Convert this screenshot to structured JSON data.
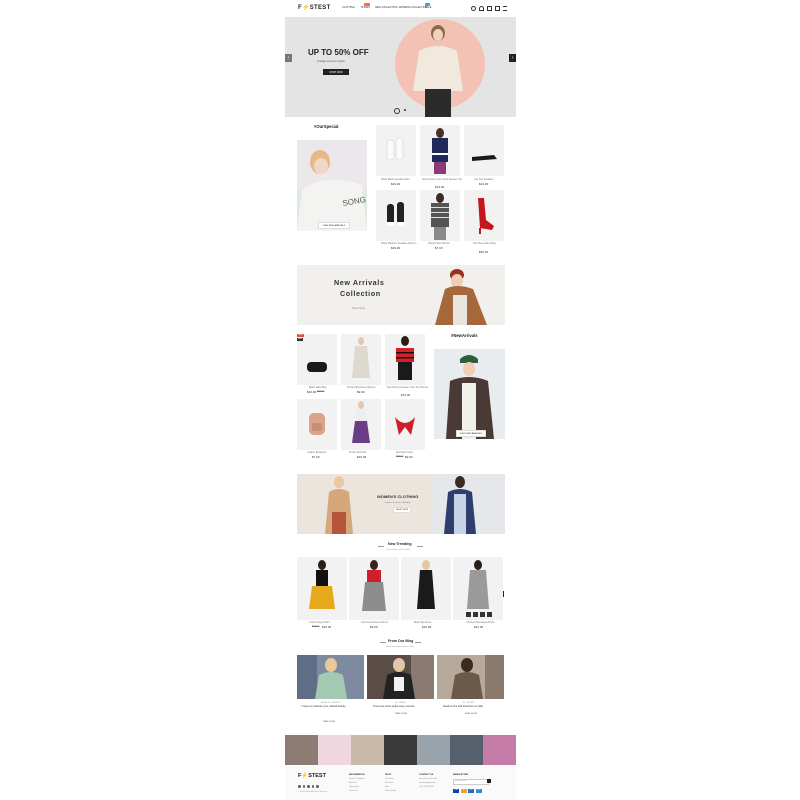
{
  "header": {
    "logo": "F⚡STEST",
    "nav": [
      "CLOTHING",
      "SHOES",
      "NEW COLLECTION",
      "WOMENS COLLECTION",
      "SALE"
    ],
    "badge_new": "NEW",
    "badge_hot": "HOT",
    "icons": [
      "search-icon",
      "user-icon",
      "heart-icon",
      "cart-icon",
      "menu-icon"
    ]
  },
  "hero": {
    "title": "UP TO 50% OFF",
    "subtitle": "vintage summer styles",
    "button": "SHOP NOW",
    "prev": "‹",
    "next": "›"
  },
  "special": {
    "title": "#OurSpecial",
    "banner_button": "VIEW NEW ARRIVALS",
    "products": [
      {
        "name": "White Black Sneakers Men",
        "price": "$29.00"
      },
      {
        "name": "Striped Navy Crew Neck Sweater Top",
        "price": "$19.00"
      },
      {
        "name": "Low Top Sneakers",
        "price": "$19.00"
      },
      {
        "name": "White Platform Sneakers Women",
        "price": "$39.00"
      },
      {
        "name": "Striped Shirt Women",
        "price": "$7.00"
      },
      {
        "name": "Red Heel Ankle Strap",
        "price": "$45.00"
      }
    ]
  },
  "arrivals_banner": {
    "title_line1": "New Arrivals",
    "title_line2": "Collection",
    "link": "Shop Now"
  },
  "new_arrivals": {
    "title": "#NewArrivals",
    "banner_button": "SHOP NEW ARRIVALS",
    "badge_sale": "SALE",
    "badge_new": "NEW",
    "products": [
      {
        "name": "Black Waist Bag",
        "price": "$30.00",
        "old_price": "$45.00"
      },
      {
        "name": "Printed Midi Dress Women",
        "price": "$9.99",
        "old_price": ""
      },
      {
        "name": "Red Striped Sweater Crop Top Women",
        "price": "$14.00",
        "old_price": ""
      },
      {
        "name": "Leather Backpack",
        "price": "$7.00",
        "old_price": ""
      },
      {
        "name": "Purple Midi Skirt",
        "price": "$19.00",
        "old_price": ""
      },
      {
        "name": "Red Neck Scarf",
        "price": "$9.00",
        "old_price": "$12.00"
      }
    ]
  },
  "womens_banner": {
    "title": "WOMEN'S CLOTHING",
    "subtitle": "autumn & winter collection",
    "button": "SHOP NOW"
  },
  "trending": {
    "title": "New Trending",
    "subtitle": "Top products of the week",
    "prev": "‹",
    "next": "›",
    "products": [
      {
        "name": "Yellow Striped Skirt",
        "price": "$10.00",
        "old_price": "$14.00"
      },
      {
        "name": "Checkered Dress Women",
        "price": "$9.99",
        "old_price": ""
      },
      {
        "name": "Black Slip Dress",
        "price": "$19.99",
        "old_price": ""
      },
      {
        "name": "Checked Sleeveless Dress",
        "price": "$12.00",
        "old_price": ""
      }
    ]
  },
  "blog": {
    "title": "From Our Blog",
    "subtitle": "Read our latest fashion news",
    "posts": [
      {
        "meta": "FASHION · TRENDS",
        "title": "7 ways to enhance your natural beauty",
        "more": "READ MORE"
      },
      {
        "meta": "BY · ADMIN",
        "title": "5 summer shoe styles every woman",
        "more": "READ MORE"
      },
      {
        "meta": "BY · ADMIN",
        "title": "Head-to-Toe Fall Favorites on Sale",
        "more": "READ MORE"
      }
    ]
  },
  "footer": {
    "logo": "F⚡STEST",
    "columns": [
      {
        "heading": "INFORMATION",
        "links": [
          "Terms & Conditions",
          "About Us",
          "Delivery Info",
          "Contact Us"
        ]
      },
      {
        "heading": "SHOP",
        "links": [
          "My Orders",
          "Newsletter",
          "Help",
          "Privacy Policy"
        ]
      },
      {
        "heading": "CONTACT US",
        "links": [
          "Demo Store, New York",
          "store@example.com",
          "(+01) 123 456 789"
        ]
      },
      {
        "heading": "NEWSLETTER",
        "links": [
          "Enter your email"
        ]
      }
    ],
    "social": [
      "facebook-icon",
      "twitter-icon",
      "pinterest-icon",
      "instagram-icon",
      "youtube-icon"
    ],
    "copyright": "© 2020 Fastest. All Rights Reserved.",
    "payments": [
      "VISA",
      "MC",
      "PP",
      "AE"
    ]
  },
  "colors": {
    "accent": "#ff6f3c",
    "dark": "#222222",
    "hero_bg": "#e4e4e4",
    "hero_circle": "#f4c1b5",
    "arrivals_bg": "#f2f0ec",
    "womens_bg": "#ebe5dd",
    "sale_badge": "#e84a3f",
    "new_badge": "#333333"
  }
}
